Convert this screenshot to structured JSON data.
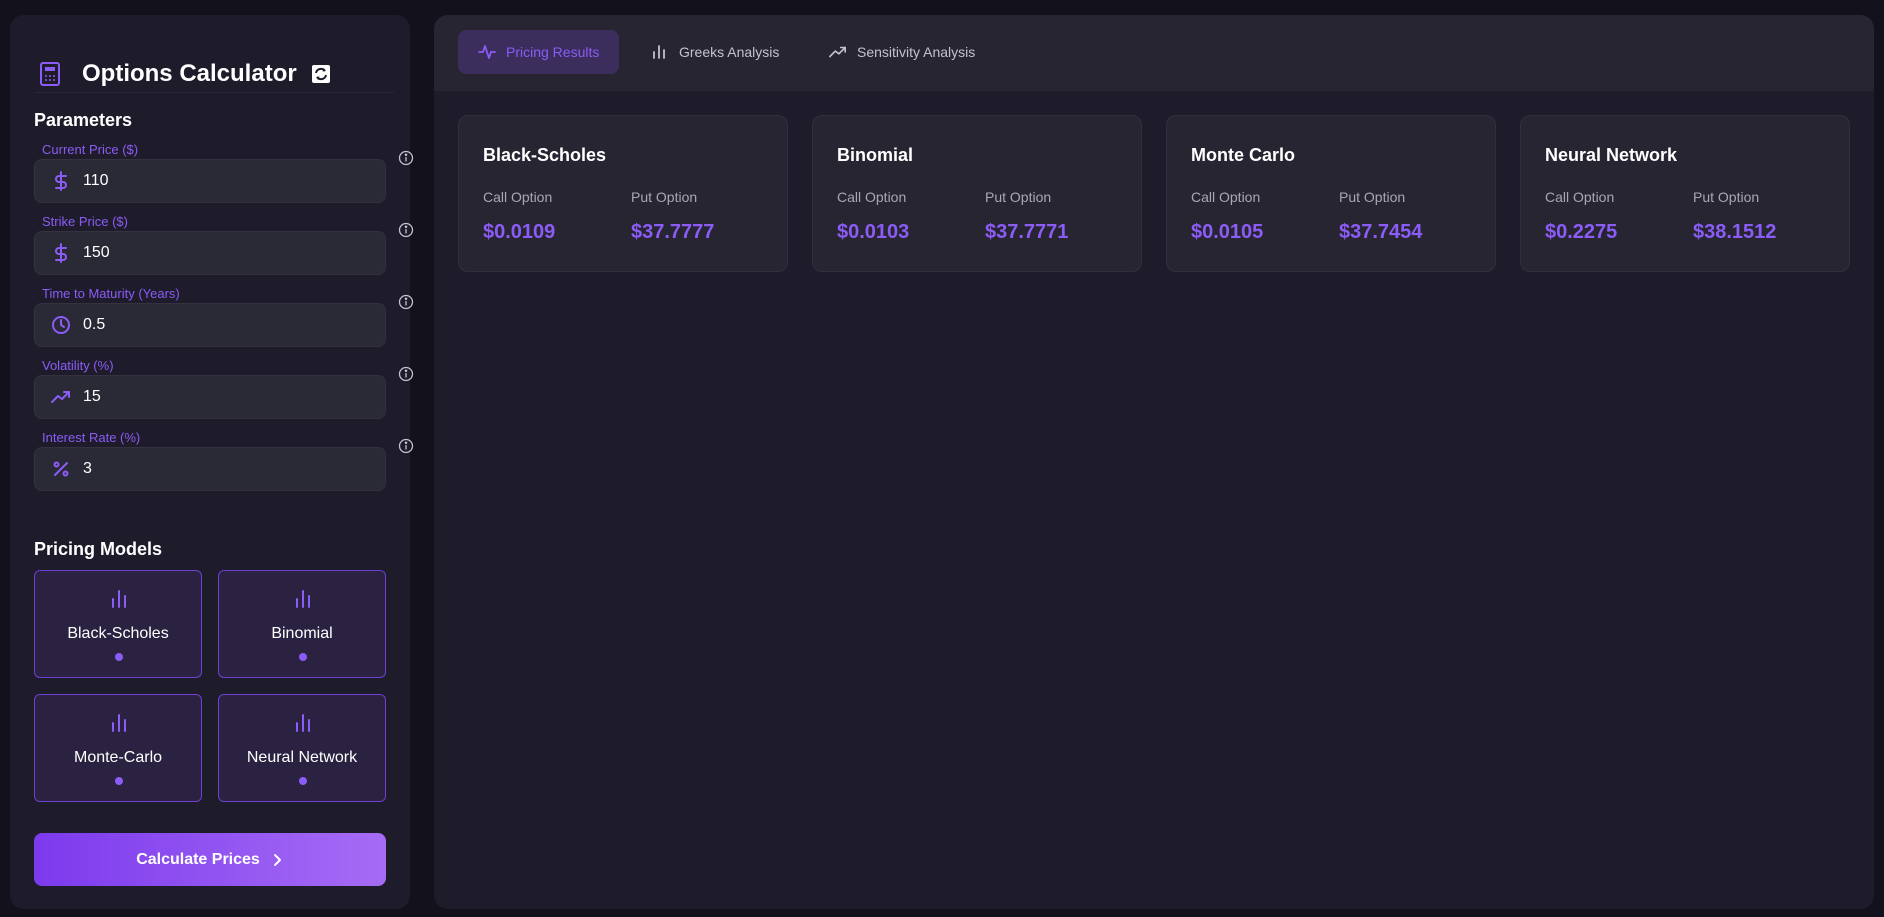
{
  "app": {
    "title": "Options Calculator"
  },
  "parameters": {
    "heading": "Parameters",
    "fields": [
      {
        "label": "Current Price ($)",
        "value": "110",
        "icon": "dollar-icon"
      },
      {
        "label": "Strike Price ($)",
        "value": "150",
        "icon": "dollar-icon"
      },
      {
        "label": "Time to Maturity (Years)",
        "value": "0.5",
        "icon": "clock-icon"
      },
      {
        "label": "Volatility (%)",
        "value": "15",
        "icon": "trending-up-icon"
      },
      {
        "label": "Interest Rate (%)",
        "value": "3",
        "icon": "percent-icon"
      }
    ]
  },
  "models": {
    "heading": "Pricing Models",
    "items": [
      {
        "label": "Black-Scholes",
        "icon": "bar-chart-icon"
      },
      {
        "label": "Binomial",
        "icon": "bar-chart-icon"
      },
      {
        "label": "Monte-Carlo",
        "icon": "bar-chart-icon"
      },
      {
        "label": "Neural Network",
        "icon": "bar-chart-icon"
      }
    ]
  },
  "calculate_button": {
    "label": "Calculate Prices",
    "icon": "chevron-right-icon"
  },
  "tabs": [
    {
      "label": "Pricing Results",
      "icon": "activity-icon",
      "active": true
    },
    {
      "label": "Greeks Analysis",
      "icon": "bar-chart-icon",
      "active": false
    },
    {
      "label": "Sensitivity Analysis",
      "icon": "trending-up-icon",
      "active": false
    }
  ],
  "results": [
    {
      "model": "Black-Scholes",
      "call_label": "Call Option",
      "call_value": "$0.0109",
      "put_label": "Put Option",
      "put_value": "$37.7777"
    },
    {
      "model": "Binomial",
      "call_label": "Call Option",
      "call_value": "$0.0103",
      "put_label": "Put Option",
      "put_value": "$37.7771"
    },
    {
      "model": "Monte Carlo",
      "call_label": "Call Option",
      "call_value": "$0.0105",
      "put_label": "Put Option",
      "put_value": "$37.7454"
    },
    {
      "model": "Neural Network",
      "call_label": "Call Option",
      "call_value": "$0.2275",
      "put_label": "Put Option",
      "put_value": "$38.1512"
    }
  ],
  "colors": {
    "accent": "#8b5cf6",
    "background": "#13121c",
    "panel": "#1e1c2b",
    "card": "#272532"
  }
}
